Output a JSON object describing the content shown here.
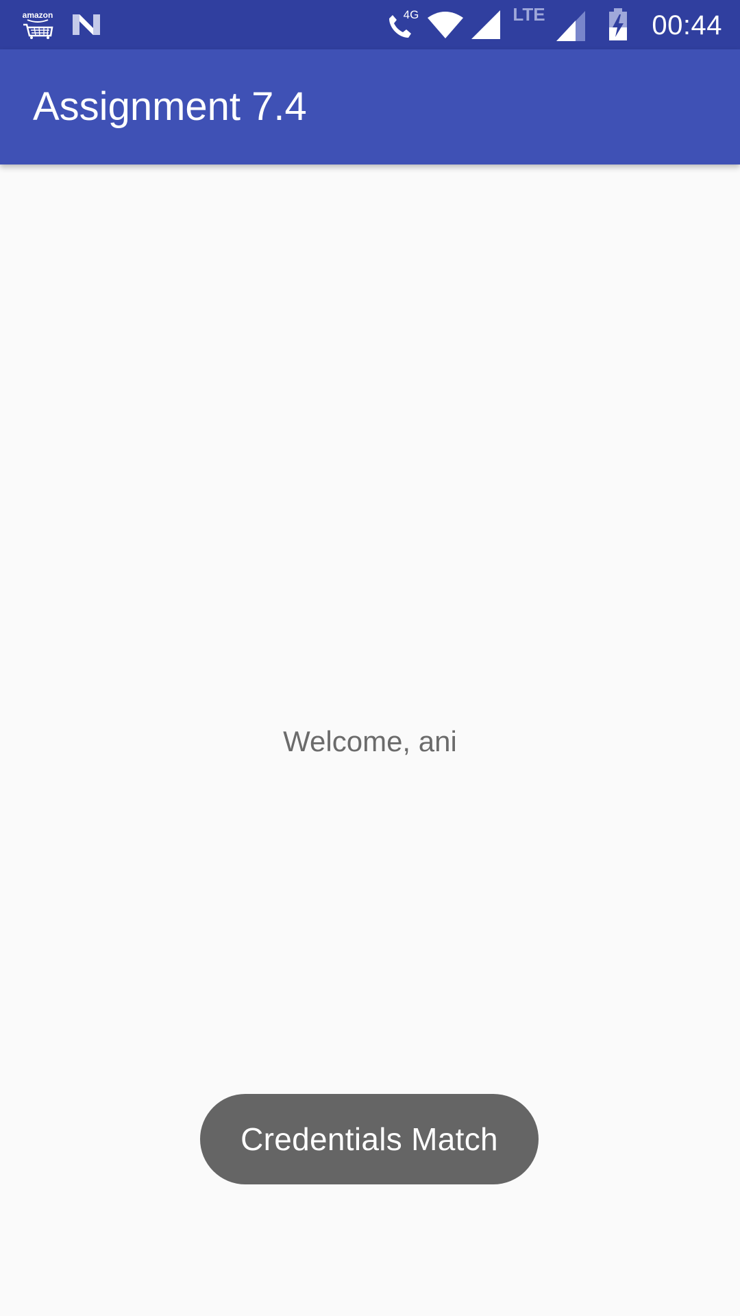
{
  "status_bar": {
    "left_icons": [
      "amazon-shopping-icon",
      "n-preview-icon"
    ],
    "amazon_label": "amazon",
    "right_icons": [
      "call-4g-icon",
      "wifi-icon",
      "signal-icon",
      "lte-signal-icon",
      "battery-charging-icon"
    ],
    "call_network_label": "4G",
    "lte_label": "LTE",
    "time": "00:44",
    "background_color": "#303f9f"
  },
  "app_bar": {
    "title": "Assignment 7.4",
    "background_color": "#3f51b5"
  },
  "main": {
    "welcome_text": "Welcome, ani"
  },
  "toast": {
    "message": "Credentials Match",
    "background_color": "#656565"
  }
}
